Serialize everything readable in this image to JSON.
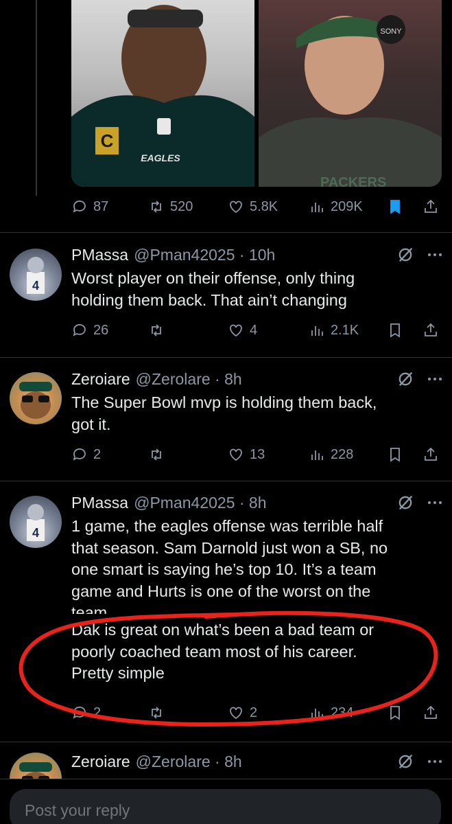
{
  "top_tweet": {
    "photos": [
      {
        "name": "eagles-player-photo",
        "jersey_text": "EAGLES",
        "patch": "C"
      },
      {
        "name": "coach-photo",
        "headset_brand": "SONY",
        "shirt_text": "PACKERS"
      }
    ],
    "actions": {
      "replies": "87",
      "retweets": "520",
      "likes": "5.8K",
      "views": "209K"
    }
  },
  "tweets": [
    {
      "display_name": "PMassa",
      "handle_time": "@Pman42025 · 10h",
      "lines": [
        "Worst player on their offense, only thing",
        "holding them back. That ain’t changing"
      ],
      "actions": {
        "replies": "26",
        "retweets": "",
        "likes": "4",
        "views": "2.1K"
      }
    },
    {
      "display_name": "Zeroiare",
      "handle_time": "@Zerolare · 8h",
      "lines": [
        "The Super Bowl mvp is holding them back,",
        "got it."
      ],
      "actions": {
        "replies": "2",
        "retweets": "",
        "likes": "13",
        "views": "228"
      }
    },
    {
      "display_name": "PMassa",
      "handle_time": "@Pman42025 · 8h",
      "lines": [
        "1 game, the eagles offense was terrible half",
        "that season. Sam Darnold just won a SB, no",
        "one smart is saying he’s top 10. It’s a team",
        "game and Hurts is one of the worst on the",
        "team",
        "Dak is great on what’s been a bad team or",
        "poorly coached team most of his career.",
        "Pretty simple"
      ],
      "actions": {
        "replies": "2",
        "retweets": "",
        "likes": "2",
        "views": "234"
      }
    },
    {
      "display_name": "Zeroiare",
      "handle_time": "@Zerolare · 8h"
    }
  ],
  "reply": {
    "placeholder": "Post your reply"
  },
  "colors": {
    "accent_blue": "#1d9bf0",
    "annotation_red": "#e8231c",
    "muted": "#8b98a5"
  }
}
